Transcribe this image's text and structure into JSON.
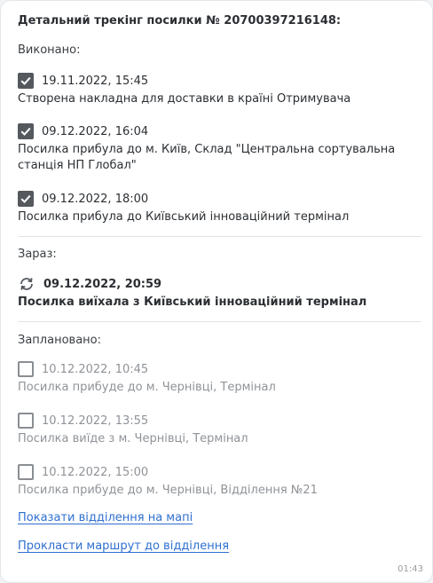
{
  "title": "Детальний трекінг посилки № 20700397216148:",
  "sections": {
    "done_label": "Виконано:",
    "now_label": "Зараз:",
    "planned_label": "Заплановано:"
  },
  "done": [
    {
      "datetime": "19.11.2022, 15:45",
      "description": "Створена накладна для доставки в країні Отримувача"
    },
    {
      "datetime": "09.12.2022, 16:04",
      "description": "Посилка прибула до м. Київ, Склад \"Центральна сортувальна станція НП Глобал\""
    },
    {
      "datetime": "09.12.2022, 18:00",
      "description": "Посилка прибула до Київський інноваційний термінал"
    }
  ],
  "now": {
    "datetime": "09.12.2022, 20:59",
    "description": "Посилка виїхала з Київський інноваційний термінал"
  },
  "planned": [
    {
      "datetime": "10.12.2022, 10:45",
      "description": "Посилка прибуде до м. Чернівці, Термінал"
    },
    {
      "datetime": "10.12.2022, 13:55",
      "description": "Посилка виїде з м. Чернівці, Термінал"
    },
    {
      "datetime": "10.12.2022, 15:00",
      "description": "Посилка прибуде до м. Чернівці, Відділення №21"
    }
  ],
  "links": {
    "show_branch_on_map": "Показати відділення на мапі",
    "build_route": "Прокласти маршрут до відділення"
  },
  "message_time": "01:43",
  "colors": {
    "link": "#2f6fd0",
    "checkbox_checked": "#55595e",
    "muted_text": "#8f9398"
  }
}
